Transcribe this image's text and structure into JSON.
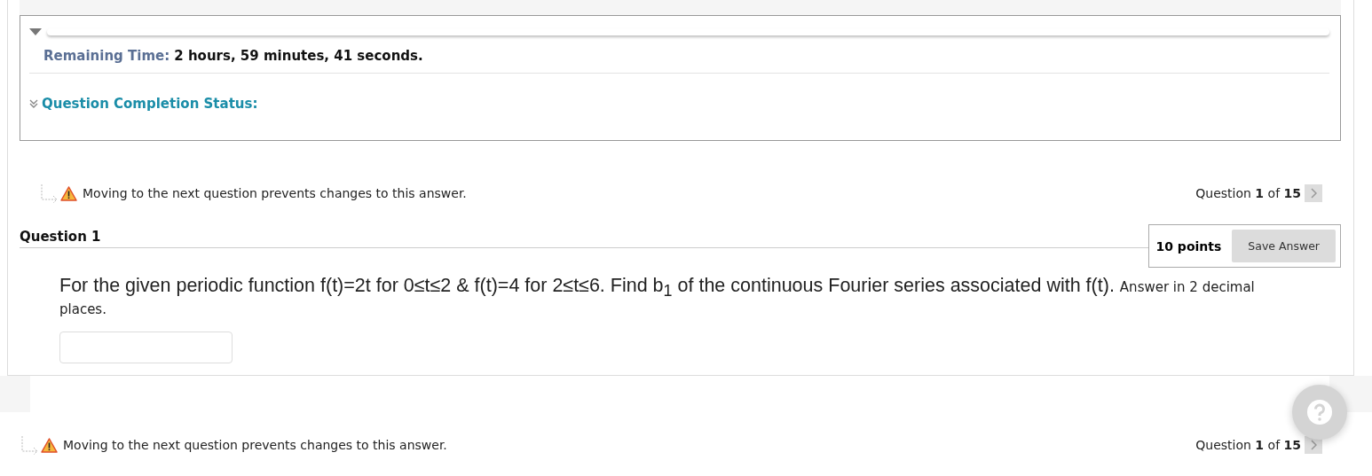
{
  "timer": {
    "label": "Remaining Time:",
    "value": "2 hours, 59 minutes, 41 seconds.",
    "expanded": true
  },
  "completion_status": {
    "label": "Question Completion Status:",
    "expanded": false
  },
  "navigation_top": {
    "warning": "Moving to the next question prevents changes to this answer.",
    "prefix": "Question",
    "current": "1",
    "of": "of",
    "total": "15"
  },
  "question": {
    "title": "Question 1",
    "points": "10 points",
    "save_button": "Save Answer",
    "prompt": "For the given periodic function f(t)=2t for 0≤t≤2 & f(t)=4 for 2≤t≤6. Find b$_{1}$ of the continuous Fourier series associated with f(t).",
    "instruction": "Answer in 2 decimal places."
  },
  "navigation_bottom": {
    "warning": "Moving to the next question prevents changes to this answer.",
    "prefix": "Question",
    "current": "1",
    "of": "of",
    "total": "15"
  }
}
